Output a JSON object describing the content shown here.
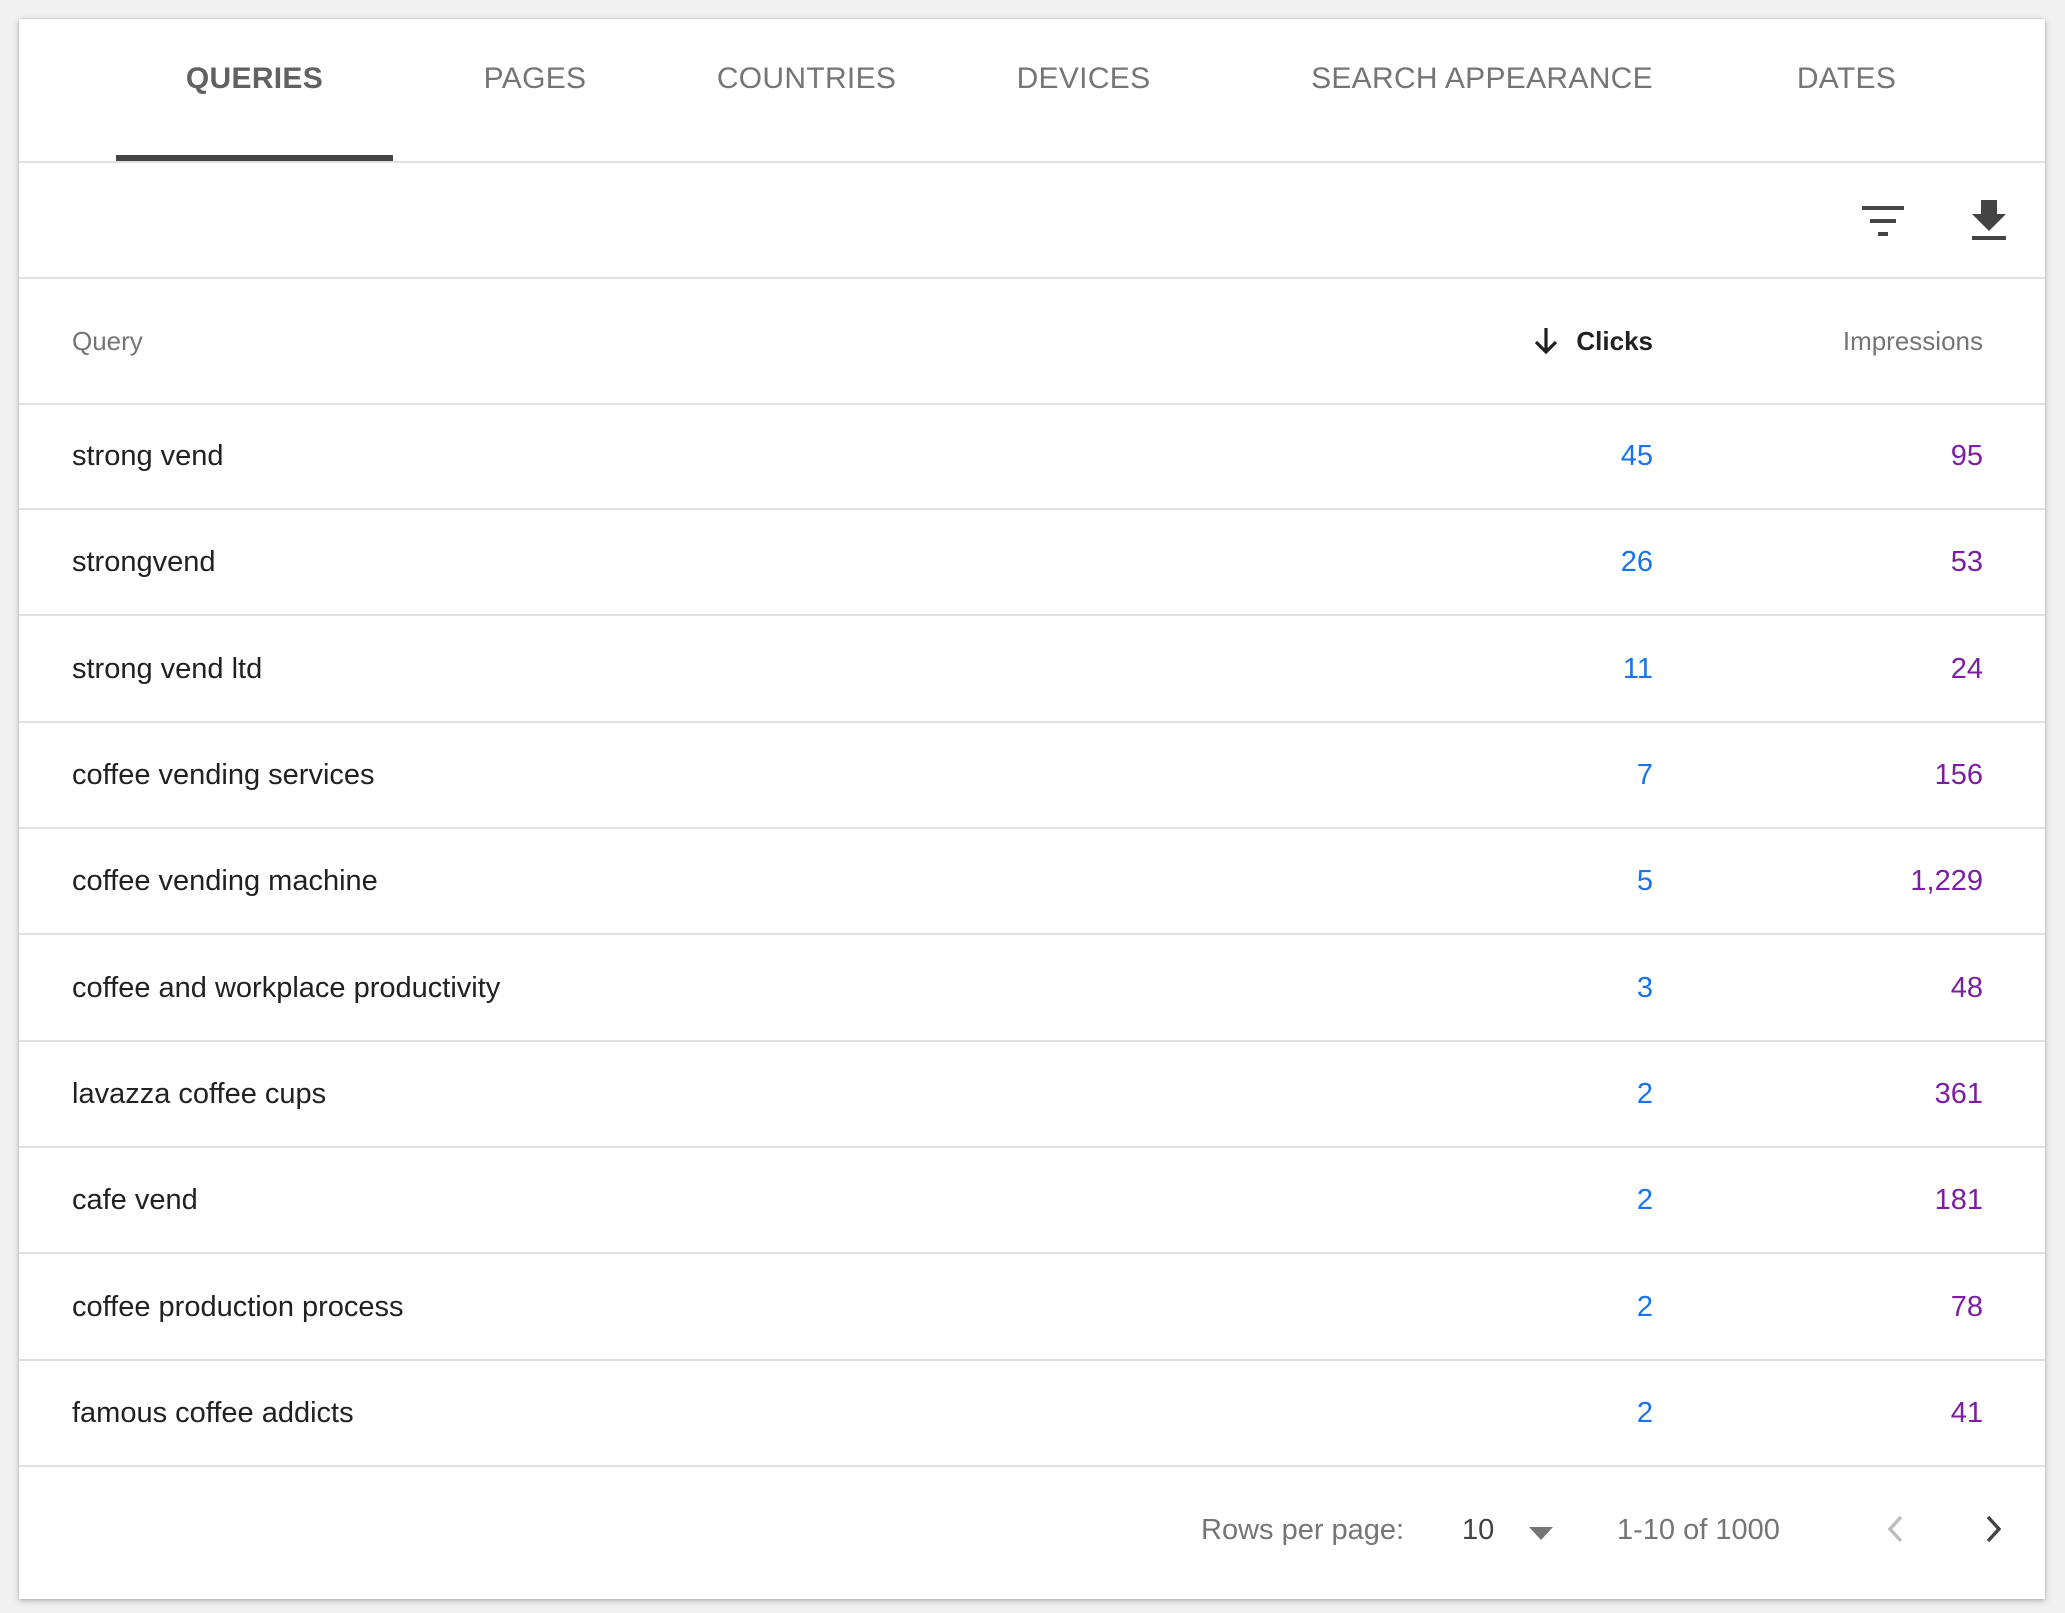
{
  "tabs": [
    {
      "label": "QUERIES",
      "active": true
    },
    {
      "label": "PAGES",
      "active": false
    },
    {
      "label": "COUNTRIES",
      "active": false
    },
    {
      "label": "DEVICES",
      "active": false
    },
    {
      "label": "SEARCH APPEARANCE",
      "active": false
    },
    {
      "label": "DATES",
      "active": false
    }
  ],
  "toolbar": {
    "filter_icon": "filter-icon",
    "download_icon": "download-icon"
  },
  "table": {
    "columns": {
      "query": "Query",
      "clicks": "Clicks",
      "impressions": "Impressions"
    },
    "sort_icon": "arrow-down-icon",
    "rows": [
      {
        "query": "strong vend",
        "clicks": "45",
        "impressions": "95"
      },
      {
        "query": "strongvend",
        "clicks": "26",
        "impressions": "53"
      },
      {
        "query": "strong vend ltd",
        "clicks": "11",
        "impressions": "24"
      },
      {
        "query": "coffee vending services",
        "clicks": "7",
        "impressions": "156"
      },
      {
        "query": "coffee vending machine",
        "clicks": "5",
        "impressions": "1,229"
      },
      {
        "query": "coffee and workplace productivity",
        "clicks": "3",
        "impressions": "48"
      },
      {
        "query": "lavazza coffee cups",
        "clicks": "2",
        "impressions": "361"
      },
      {
        "query": "cafe vend",
        "clicks": "2",
        "impressions": "181"
      },
      {
        "query": "coffee production process",
        "clicks": "2",
        "impressions": "78"
      },
      {
        "query": "famous coffee addicts",
        "clicks": "2",
        "impressions": "41"
      }
    ]
  },
  "footer": {
    "rows_per_page_label": "Rows per page:",
    "rows_per_page_value": "10",
    "range": "1-10 of 1000"
  },
  "colors": {
    "clicks": "#1a73e8",
    "impressions": "#7b1fa2",
    "tab_underline": "#444444"
  }
}
